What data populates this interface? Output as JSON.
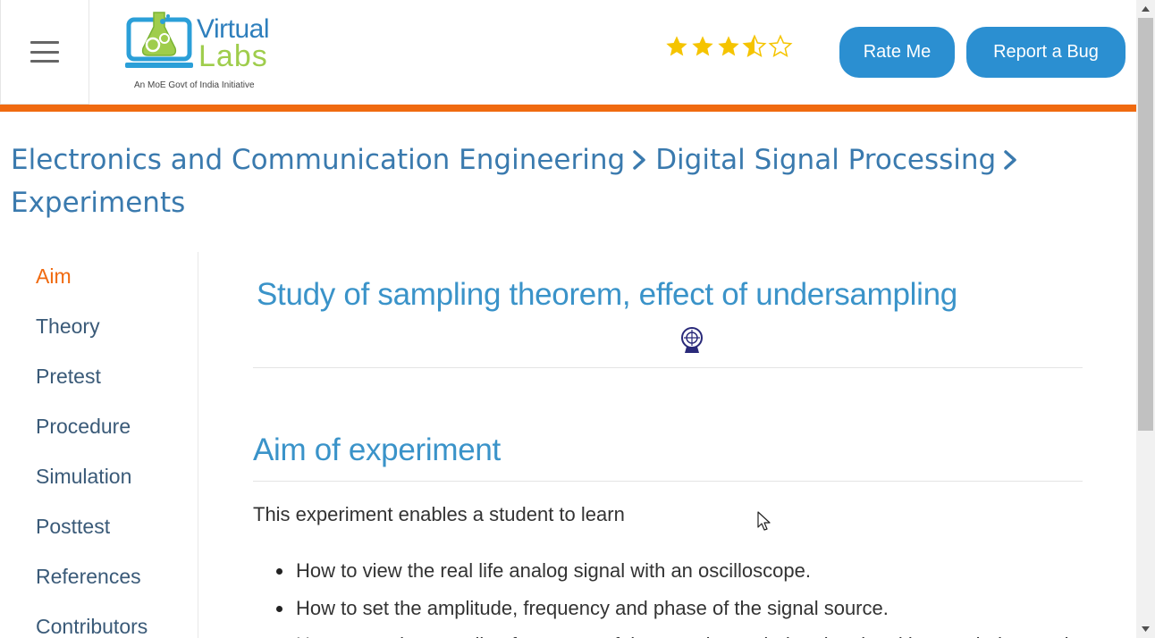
{
  "header": {
    "menu_icon": "hamburger-icon",
    "logo": {
      "line1": "Virtual",
      "line2": "Labs",
      "tagline": "An MoE Govt of India Initiative"
    },
    "rating": {
      "value": 3.5,
      "max": 5,
      "color": "#f5c400"
    },
    "rate_button": "Rate Me",
    "bug_button": "Report a Bug",
    "accent_color": "#f06a10",
    "button_color": "#2b8fd1"
  },
  "breadcrumb": {
    "items": [
      "Electronics and Communication Engineering",
      "Digital Signal Processing",
      "Experiments"
    ]
  },
  "sidebar": {
    "items": [
      {
        "label": "Aim",
        "active": true
      },
      {
        "label": "Theory"
      },
      {
        "label": "Pretest"
      },
      {
        "label": "Procedure"
      },
      {
        "label": "Simulation"
      },
      {
        "label": "Posttest"
      },
      {
        "label": "References"
      },
      {
        "label": "Contributors"
      }
    ]
  },
  "main": {
    "title": "Study of sampling theorem, effect of undersampling",
    "institute_logo_icon": "institute-emblem-icon",
    "section_title": "Aim of experiment",
    "intro": "This experiment enables a student to learn",
    "bullets": [
      "How to view the real life analog signal with an oscilloscope.",
      "How to set the amplitude, frequency and phase of the signal source.",
      "How to set the sampling frequency of the sampler such that the signal is sampled properly."
    ]
  }
}
